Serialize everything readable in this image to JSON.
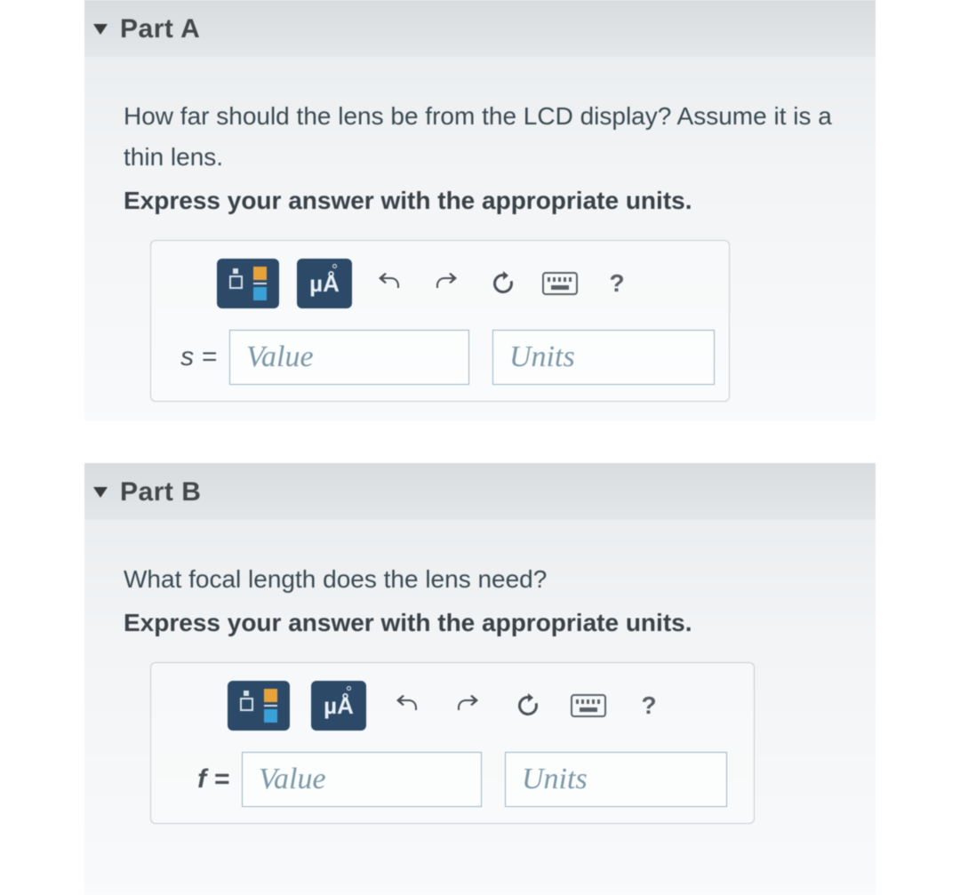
{
  "toolbar_labels": {
    "mu_a": "µÅ",
    "help": "?"
  },
  "input_placeholders": {
    "value": "Value",
    "units": "Units"
  },
  "parts": {
    "a": {
      "title": "Part A",
      "question": "How far should the lens be from the LCD display? Assume it is a thin lens.",
      "hint": "Express your answer with the appropriate units.",
      "variable": "s ="
    },
    "b": {
      "title": "Part B",
      "question": "What focal length does the lens need?",
      "hint": "Express your answer with the appropriate units.",
      "variable": "f ="
    }
  }
}
